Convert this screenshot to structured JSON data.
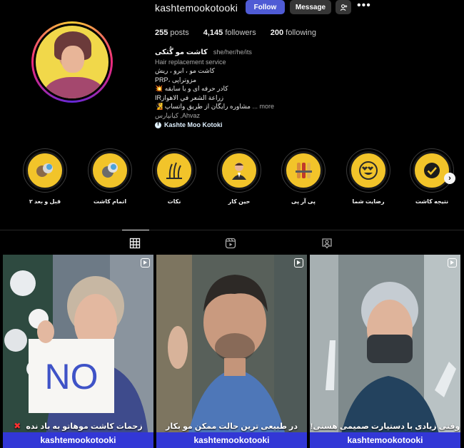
{
  "profile": {
    "username": "kashtemookotooki",
    "follow_label": "Follow",
    "message_label": "Message",
    "suggest_icon": "add-person-icon",
    "more_icon": "more-horizontal-icon",
    "stats": {
      "posts_count": "255",
      "posts_label": "posts",
      "followers_count": "4,145",
      "followers_label": "followers",
      "following_count": "200",
      "following_label": "following"
    },
    "bio": {
      "name": "کاشت مو گُتکی",
      "pronouns": "she/her/he/its",
      "category": "Hair replacement service",
      "lines": [
        "کاشت مو ، ابرو ، ریش",
        "PRP، مزوتراپی",
        "💥 کادر حرفه ای و با سابقه",
        "IRزراعة الشعر في الاهواز",
        "🧏 مشاوره رایگان از طریق واتساپ"
      ],
      "more_label": "... more",
      "location": "کیانپارس ,Ahvaz",
      "facebook_label": "Kashte Moo Kotoki"
    }
  },
  "highlights": [
    {
      "label": "قبل و بعد ۲",
      "icon": "before-after-icon"
    },
    {
      "label": "اتمام کاشت",
      "icon": "hair-check-icon"
    },
    {
      "label": "نکات",
      "icon": "hair-follicle-icon"
    },
    {
      "label": "حین کار",
      "icon": "doctor-icon"
    },
    {
      "label": "پی آر پی",
      "icon": "test-tubes-icon"
    },
    {
      "label": "رضایت شما",
      "icon": "heart-eyes-icon"
    },
    {
      "label": "نتیجه کاشت",
      "icon": "checkmark-icon"
    }
  ],
  "tabs": [
    {
      "name": "posts",
      "icon": "grid-icon",
      "active": true
    },
    {
      "name": "reels",
      "icon": "reels-icon",
      "active": false
    },
    {
      "name": "tagged",
      "icon": "tagged-icon",
      "active": false
    }
  ],
  "posts": [
    {
      "caption": "زحمات کاشت موهاتو به باد نده",
      "brand": "kashtemookotooki",
      "sign_text": "NO",
      "has_x": true
    },
    {
      "caption": "در طبیعی ترین حالت ممکن مو بکار",
      "brand": "kashtemookotooki",
      "has_x": false
    },
    {
      "caption": "وقتی زیادی با دستیارت صمیمی هستی!",
      "brand": "kashtemookotooki",
      "has_x": false
    }
  ],
  "colors": {
    "follow_button": "#4f5bd5",
    "highlight_fill": "#f2c42a",
    "brand_bar": "#3237d6"
  }
}
